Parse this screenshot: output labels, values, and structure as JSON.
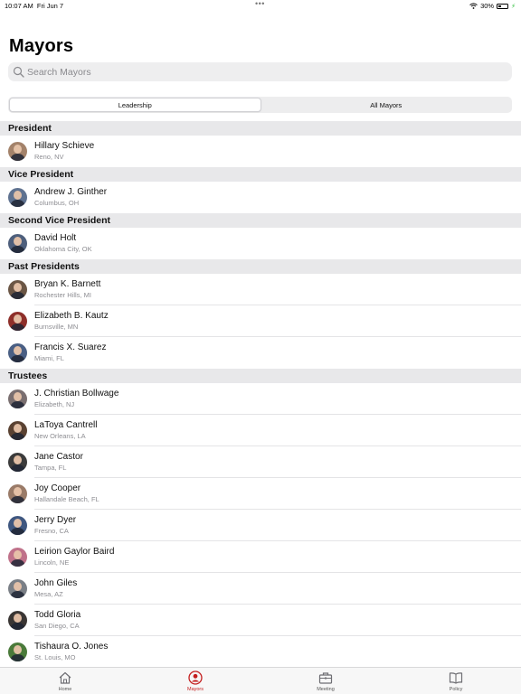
{
  "status_bar": {
    "time": "10:07 AM",
    "date": "Fri Jun 7",
    "dots": "•••",
    "battery": "30%"
  },
  "page": {
    "title": "Mayors"
  },
  "search": {
    "placeholder": "Search Mayors"
  },
  "segments": {
    "leadership": "Leadership",
    "all_mayors": "All Mayors"
  },
  "sections": [
    {
      "title": "President",
      "people": [
        {
          "name": "Hillary Schieve",
          "location": "Reno, NV",
          "color": "#a3826a"
        }
      ]
    },
    {
      "title": "Vice President",
      "people": [
        {
          "name": "Andrew J. Ginther",
          "location": "Columbus, OH",
          "color": "#5f7290"
        }
      ]
    },
    {
      "title": "Second Vice President",
      "people": [
        {
          "name": "David Holt",
          "location": "Oklahoma City, OK",
          "color": "#4e5f7c"
        }
      ]
    },
    {
      "title": "Past Presidents",
      "people": [
        {
          "name": "Bryan K. Barnett",
          "location": "Rochester Hills, MI",
          "color": "#6b5645"
        },
        {
          "name": "Elizabeth B. Kautz",
          "location": "Burnsville, MN",
          "color": "#8e2f2a"
        },
        {
          "name": "Francis X. Suarez",
          "location": "Miami, FL",
          "color": "#4a5f84"
        }
      ]
    },
    {
      "title": "Trustees",
      "people": [
        {
          "name": "J. Christian Bollwage",
          "location": "Elizabeth, NJ",
          "color": "#7a6f70"
        },
        {
          "name": "LaToya Cantrell",
          "location": "New Orleans, LA",
          "color": "#5a4232"
        },
        {
          "name": "Jane Castor",
          "location": "Tampa, FL",
          "color": "#3b3b3b"
        },
        {
          "name": "Joy Cooper",
          "location": "Hallandale Beach, FL",
          "color": "#9a7b68"
        },
        {
          "name": "Jerry Dyer",
          "location": "Fresno, CA",
          "color": "#3f5780"
        },
        {
          "name": "Leirion Gaylor Baird",
          "location": "Lincoln, NE",
          "color": "#c0728a"
        },
        {
          "name": "John Giles",
          "location": "Mesa, AZ",
          "color": "#7a7f86"
        },
        {
          "name": "Todd Gloria",
          "location": "San Diego, CA",
          "color": "#3a3634"
        },
        {
          "name": "Tishaura O. Jones",
          "location": "St. Louis, MO",
          "color": "#4a7a3a"
        }
      ]
    }
  ],
  "tabs": [
    {
      "label": "Home",
      "icon": "home-icon",
      "active": false
    },
    {
      "label": "Mayors",
      "icon": "person-circle-icon",
      "active": true
    },
    {
      "label": "Meeting",
      "icon": "briefcase-icon",
      "active": false
    },
    {
      "label": "Policy",
      "icon": "book-icon",
      "active": false
    }
  ],
  "colors": {
    "accent": "#c41e1e",
    "secondary_text": "#8e8e93",
    "section_bg": "#e8e8ea"
  }
}
